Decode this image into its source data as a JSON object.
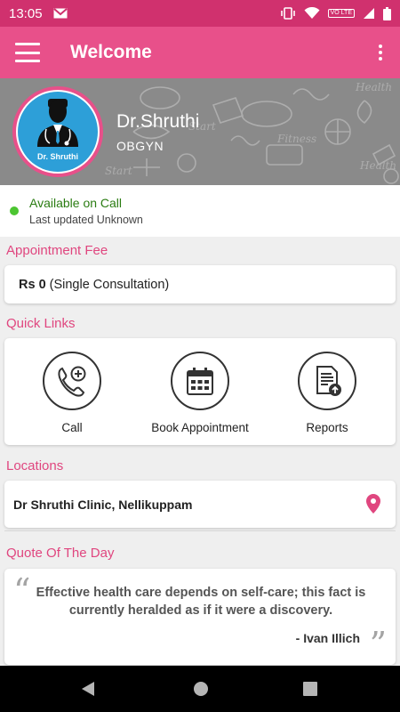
{
  "status_bar": {
    "time": "13:05",
    "volte": "VO LTE"
  },
  "app_bar": {
    "title": "Welcome"
  },
  "profile": {
    "avatar_label": "Dr. Shruthi",
    "name": "Dr.Shruthi",
    "specialty": "OBGYN"
  },
  "availability": {
    "status": "Available on Call",
    "updated": "Last updated Unknown",
    "status_color": "#4cc531"
  },
  "appointment_fee": {
    "title": "Appointment Fee",
    "amount": "Rs 0",
    "note": "(Single Consultation)"
  },
  "quick_links": {
    "title": "Quick Links",
    "items": [
      {
        "label": "Call",
        "icon": "phone-plus-icon"
      },
      {
        "label": "Book Appointment",
        "icon": "calendar-icon"
      },
      {
        "label": "Reports",
        "icon": "report-upload-icon"
      }
    ]
  },
  "locations": {
    "title": "Locations",
    "items": [
      {
        "name": "Dr Shruthi Clinic, Nellikuppam",
        "icon": "location-pin-icon"
      }
    ]
  },
  "quote": {
    "title": "Quote Of The Day",
    "text": "Effective health care depends on self-care; this fact is currently heralded as if it were a discovery.",
    "author": "- Ivan Illich"
  },
  "colors": {
    "status_bar": "#d0316e",
    "app_bar": "#e8508a",
    "accent": "#e0467f",
    "avatar_bg": "#2d9fd8"
  }
}
